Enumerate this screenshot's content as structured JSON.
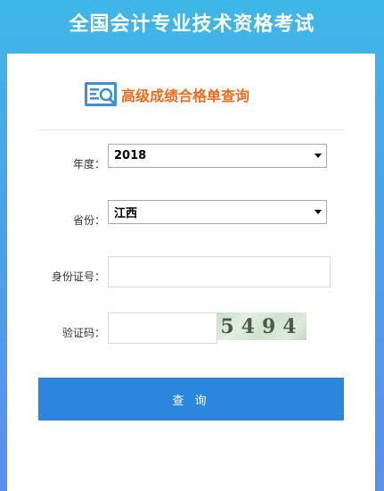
{
  "header": {
    "title": "全国会计专业技术资格考试"
  },
  "subtitle": {
    "text": "高级成绩合格单查询",
    "icon": "magnifier-list-icon"
  },
  "form": {
    "year": {
      "label": "年度：",
      "value": "2018"
    },
    "province": {
      "label": "省份：",
      "value": "江西"
    },
    "id_number": {
      "label": "身份证号：",
      "value": "",
      "placeholder": ""
    },
    "captcha": {
      "label": "验证码：",
      "value": "",
      "image_text": "5494"
    }
  },
  "submit": {
    "label": "查 询"
  },
  "colors": {
    "accent": "#2b86de",
    "subtitle": "#f26a1b",
    "background_top": "#3fb7e8",
    "background_bottom": "#5b8ff0"
  }
}
